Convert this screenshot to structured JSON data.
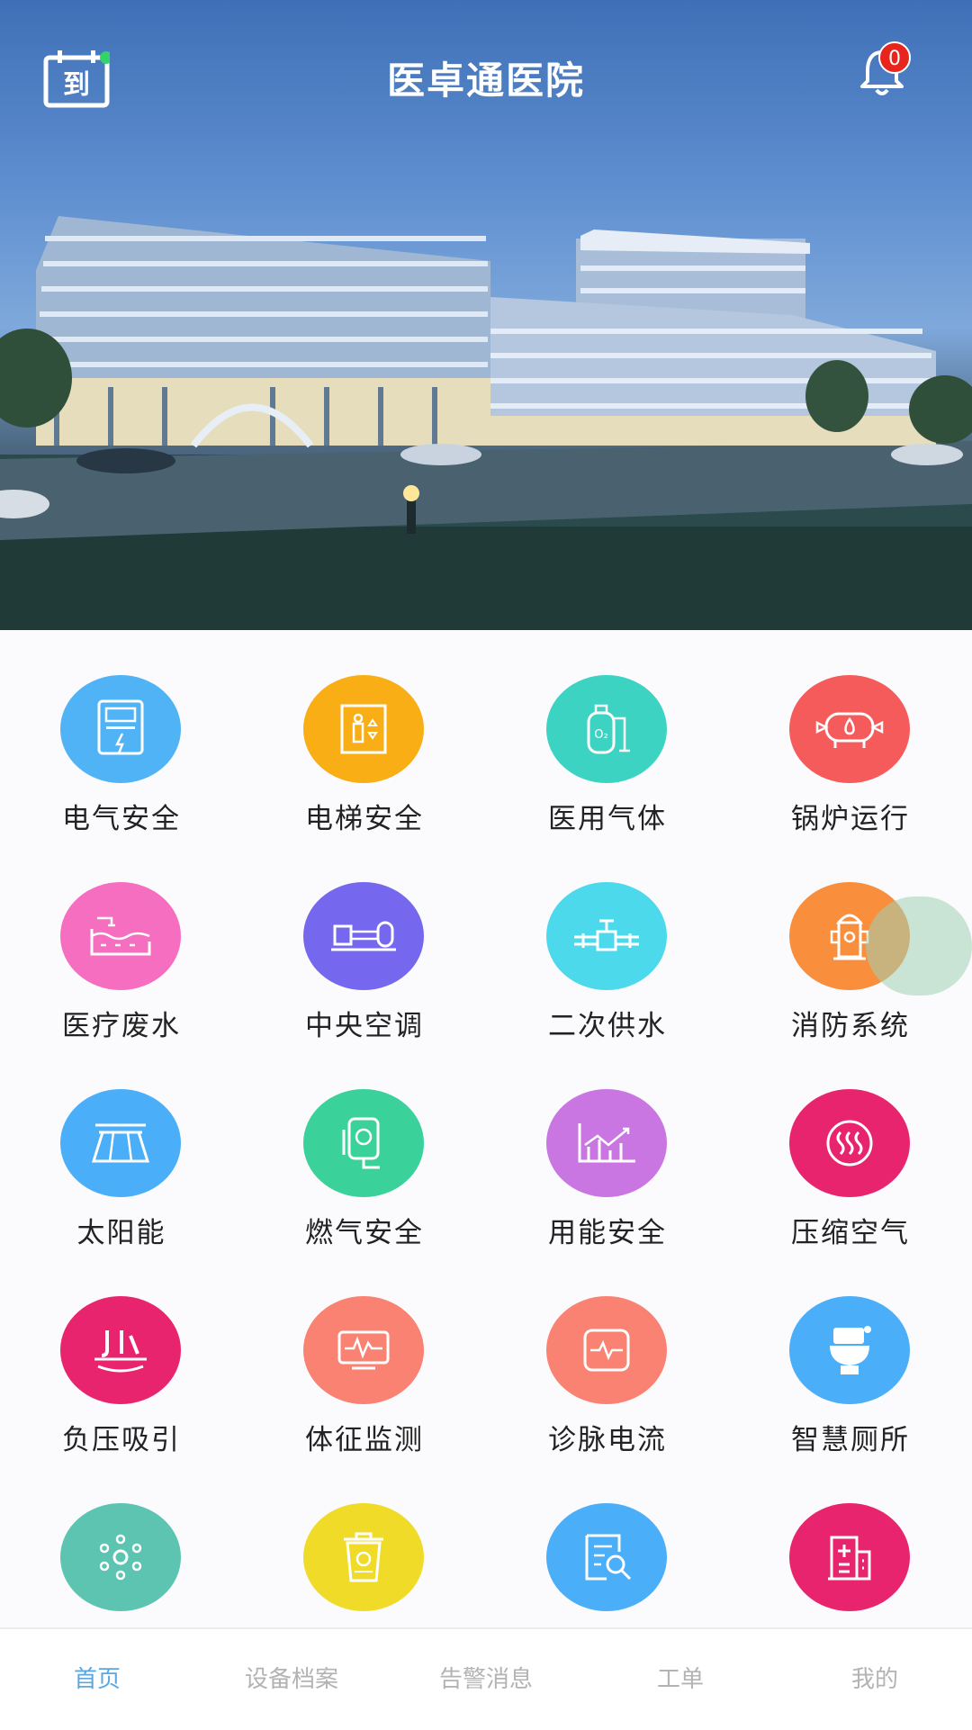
{
  "header": {
    "title": "医卓通医院",
    "checkin_label": "到",
    "notification_count": "0"
  },
  "tiles": [
    {
      "label": "电气安全",
      "icon": "meter-icon",
      "color": "#4fb3f6"
    },
    {
      "label": "电梯安全",
      "icon": "elevator-icon",
      "color": "#f8ae14"
    },
    {
      "label": "医用气体",
      "icon": "oxygen-tank-icon",
      "color": "#3cd3c2"
    },
    {
      "label": "锅炉运行",
      "icon": "boiler-icon",
      "color": "#f65b5b"
    },
    {
      "label": "医疗废水",
      "icon": "wastewater-icon",
      "color": "#f56ec0"
    },
    {
      "label": "中央空调",
      "icon": "hvac-icon",
      "color": "#7568ee"
    },
    {
      "label": "二次供水",
      "icon": "water-pipe-icon",
      "color": "#4cd9ec"
    },
    {
      "label": "消防系统",
      "icon": "fire-hydrant-icon",
      "color": "#f98f3d"
    },
    {
      "label": "太阳能",
      "icon": "solar-panel-icon",
      "color": "#4aaef8"
    },
    {
      "label": "燃气安全",
      "icon": "gas-meter-icon",
      "color": "#3ad19b"
    },
    {
      "label": "用能安全",
      "icon": "energy-chart-icon",
      "color": "#c976e3"
    },
    {
      "label": "压缩空气",
      "icon": "heat-waves-icon",
      "color": "#e9246e"
    },
    {
      "label": "负压吸引",
      "icon": "suction-icon",
      "color": "#e9246e"
    },
    {
      "label": "体征监测",
      "icon": "vital-monitor-icon",
      "color": "#fa8272"
    },
    {
      "label": "诊脉电流",
      "icon": "pulse-icon",
      "color": "#fa8272"
    },
    {
      "label": "智慧厕所",
      "icon": "toilet-icon",
      "color": "#4aaef8"
    },
    {
      "label": "",
      "icon": "network-nodes-icon",
      "color": "#5cc4b1"
    },
    {
      "label": "",
      "icon": "biohazard-bin-icon",
      "color": "#f0db28"
    },
    {
      "label": "",
      "icon": "document-search-icon",
      "color": "#4aaef8"
    },
    {
      "label": "",
      "icon": "hospital-building-icon",
      "color": "#e9246e"
    }
  ],
  "tabbar": {
    "items": [
      {
        "label": "首页",
        "active": true
      },
      {
        "label": "设备档案",
        "active": false
      },
      {
        "label": "告警消息",
        "active": false
      },
      {
        "label": "工单",
        "active": false
      },
      {
        "label": "我的",
        "active": false
      }
    ]
  }
}
